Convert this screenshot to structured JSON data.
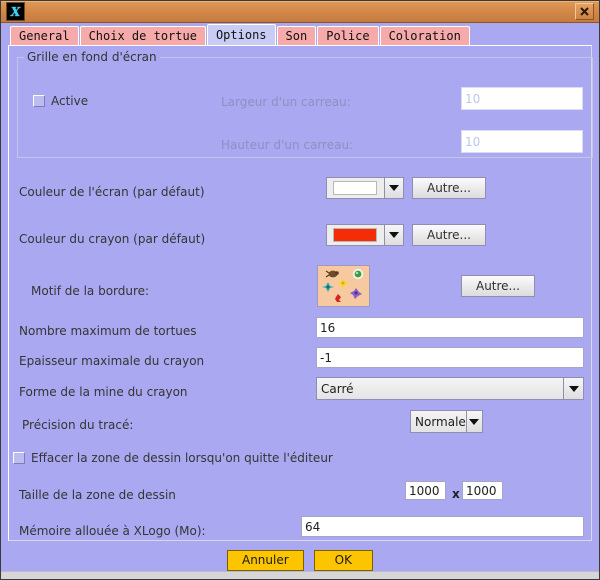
{
  "window": {
    "app_icon_glyph": "X",
    "close_label": "close-icon",
    "bg_color": "#a9a8f0",
    "titlebar_color": "#d4894a"
  },
  "tabs": [
    {
      "label": "General",
      "selected": false
    },
    {
      "label": "Choix de tortue",
      "selected": false
    },
    {
      "label": "Options",
      "selected": true
    },
    {
      "label": "Son",
      "selected": false
    },
    {
      "label": "Police",
      "selected": false
    },
    {
      "label": "Coloration",
      "selected": false
    }
  ],
  "grid_group": {
    "title": "Grille en fond d'écran",
    "active_label": "Active",
    "active_checked": false,
    "width_label": "Largeur d'un carreau:",
    "width_value": "10",
    "height_label": "Hauteur d'un carreau:",
    "height_value": "10",
    "disabled": true
  },
  "screen_color": {
    "label": "Couleur de l'écran (par défaut)",
    "value_color": "#ffffff",
    "other_label": "Autre..."
  },
  "pen_color": {
    "label": "Couleur du crayon (par défaut)",
    "value_color": "#f42c07",
    "other_label": "Autre..."
  },
  "border_motif": {
    "label": "Motif de la bordure:",
    "other_label": "Autre...",
    "bg_color": "#f6c9a0"
  },
  "max_turtles": {
    "label": "Nombre maximum de tortues",
    "value": "16"
  },
  "max_pen_width": {
    "label": "Epaisseur maximale du crayon",
    "value": "-1"
  },
  "pen_shape": {
    "label": "Forme de la mine du crayon",
    "value": "Carré"
  },
  "precision": {
    "label": "Précision du tracé:",
    "value": "Normale"
  },
  "clear_on_exit": {
    "label": "Effacer la zone de dessin lorsqu'on quitte l'éditeur",
    "checked": false
  },
  "drawing_size": {
    "label": "Taille de la zone de dessin",
    "width": "1000",
    "separator": "x",
    "height": "1000"
  },
  "memory": {
    "label": "Mémoire allouée à XLogo (Mo):",
    "value": "64"
  },
  "footer": {
    "cancel_label": "Annuler",
    "ok_label": "OK"
  }
}
